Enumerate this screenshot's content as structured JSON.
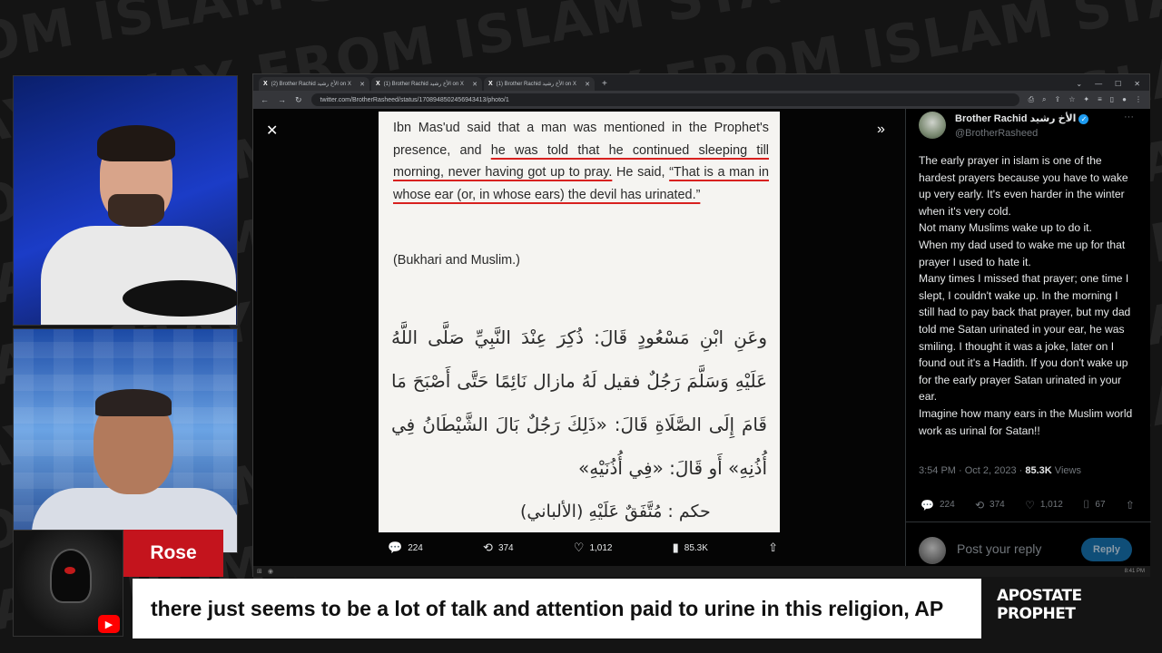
{
  "watermark": {
    "lines": [
      "FROM ISLAM STAY AWAY FROM ISLAM STAY AWAY",
      "STAY AWAY FROM ISLAM STAY AWAY FROM ISLAM STAY",
      "FROM ISLAM STAY AWAY FROM ISLAM STAY AWAY FROM",
      "AWAY FROM ISLAM STAY AWAY FROM ISLAM STAY",
      "ISLAM STAY AWAY FROM ISLAM STAY AWAY FROM",
      "STAY AWAY FROM ISLAM STAY AWAY FROM ISLAM",
      "FROM ISLAM STAY AWAY FROM ISLAM STAY AWAY",
      "AWAY FROM ISLAM STAY AWAY FROM ISLAM STAY"
    ]
  },
  "nameplate": {
    "name": "Rose",
    "yt_icon": "youtube-icon"
  },
  "browser": {
    "tabs": [
      {
        "label": "(2) Brother Rachid الأخ رشيد on X"
      },
      {
        "label": "(1) Brother Rachid الأخ رشيد on X"
      },
      {
        "label": "(1) Brother Rachid الأخ رشيد on X"
      }
    ],
    "url": "twitter.com/BrotherRasheed/status/1708948502456943413/photo/1"
  },
  "document": {
    "english_before": "Ibn Mas'ud said that a man was mentioned in the Prophet's presence, and ",
    "english_underlined_1": "he was told that he continued sleeping till morning, never having got up to pray.",
    "english_middle": " He said, ",
    "english_underlined_2": "“That is a man in whose ear (or, in whose ears) the devil has urinated.”",
    "reference": "(Bukhari and Muslim.)",
    "arabic": "وعَنِ ابْنِ مَسْعُودٍ قَالَ: ذُكِرَ عِنْدَ النَّبِيِّ صَلَّى اللَّهُ عَلَيْهِ وَسَلَّمَ رَجُلٌ فقيل لَهُ مازال نَائِمًا حَتَّى أَصْبَحَ مَا قَامَ إِلَى الصَّلَاةِ قَالَ: «ذَلِكَ رَجُلٌ بَالَ الشَّيْطَانُ فِي أُذُنِهِ» أَو قَالَ: «فِي أُذُنَيْهِ»",
    "hukm": "حكم : مُتَّفَقٌ عَلَيْهِ (الألباني)"
  },
  "viewer_actions": {
    "replies": "224",
    "reposts": "374",
    "likes": "1,012",
    "views": "85.3K"
  },
  "tweet": {
    "display_name": "Brother Rachid الأخ رشيد",
    "handle": "@BrotherRasheed",
    "paragraphs": [
      "The early prayer in islam is one of the hardest prayers because you have to wake up very early. It's even harder in the winter when it's very cold.",
      "Not many Muslims wake up to do it.",
      "When my dad used to wake me up for that prayer I used to hate it.",
      "Many times I missed that prayer; one time I slept, I couldn't wake up. In the morning I still had to pay back that prayer, but my dad told me Satan urinated in your ear, he was smiling. I thought it was a joke, later on I found out it's a Hadith. If you don't wake up for the early prayer Satan urinated in your ear.",
      "Imagine how many ears in the Muslim world work as urinal for Satan!!"
    ],
    "time": "3:54 PM · Oct 2, 2023 · ",
    "views_count": "85.3K",
    "views_label": " Views",
    "replies": "224",
    "reposts": "374",
    "likes": "1,012",
    "bookmarks": "67",
    "reply_placeholder": "Post your reply",
    "reply_button": "Reply"
  },
  "taskbar": {
    "clock": "8:41 PM"
  },
  "caption": "there just seems to be a lot of talk and attention paid to urine in this religion, AP",
  "brand": "APOSTATE PROPHET",
  "colors": {
    "highlight_underline": "#d8211f",
    "nameplate_red": "#c4141d",
    "verified": "#1d9bf0"
  }
}
